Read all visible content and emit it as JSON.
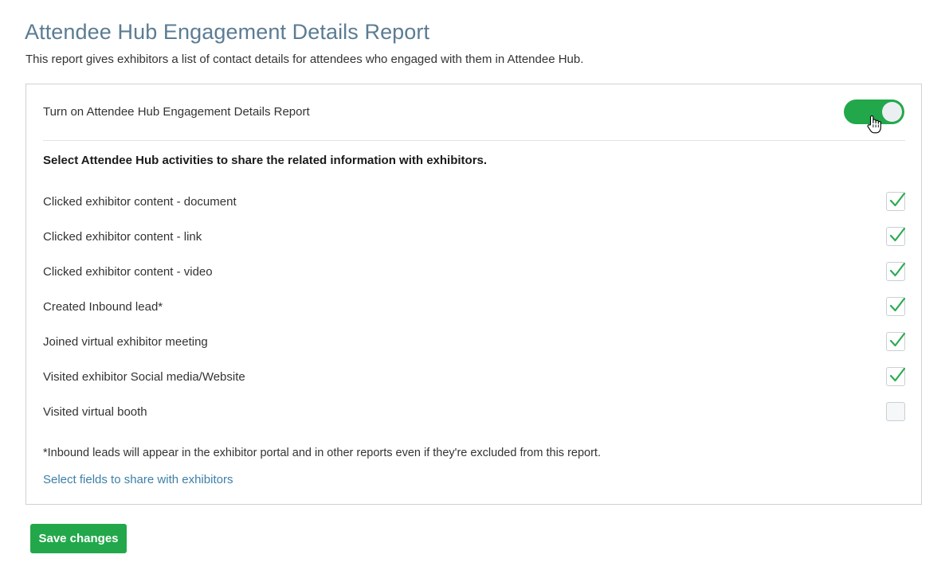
{
  "page": {
    "title": "Attendee Hub Engagement Details Report",
    "description": "This report gives exhibitors a list of contact details for attendees who engaged with them in Attendee Hub."
  },
  "card": {
    "toggle": {
      "label": "Turn on Attendee Hub Engagement Details Report",
      "state": "on"
    },
    "section_heading": "Select Attendee Hub activities to share the related information with exhibitors.",
    "activities": [
      {
        "label": "Clicked exhibitor content - document",
        "checked": true
      },
      {
        "label": "Clicked exhibitor content - link",
        "checked": true
      },
      {
        "label": "Clicked exhibitor content - video",
        "checked": true
      },
      {
        "label": "Created Inbound lead*",
        "checked": true
      },
      {
        "label": "Joined virtual exhibitor meeting",
        "checked": true
      },
      {
        "label": "Visited exhibitor Social media/Website",
        "checked": true
      },
      {
        "label": "Visited virtual booth",
        "checked": false
      }
    ],
    "footnote": "*Inbound leads will appear in the exhibitor portal and in other reports even if they're excluded from this report.",
    "link": "Select fields to share with exhibitors"
  },
  "actions": {
    "save_label": "Save changes"
  },
  "colors": {
    "accent_green": "#22a84a",
    "title_blue": "#5b7c93",
    "link_blue": "#3c7fa8",
    "check_green": "#2eab53",
    "border_gray": "#cdd2d4"
  },
  "cursor": {
    "icon": "pointing-hand-cursor"
  }
}
